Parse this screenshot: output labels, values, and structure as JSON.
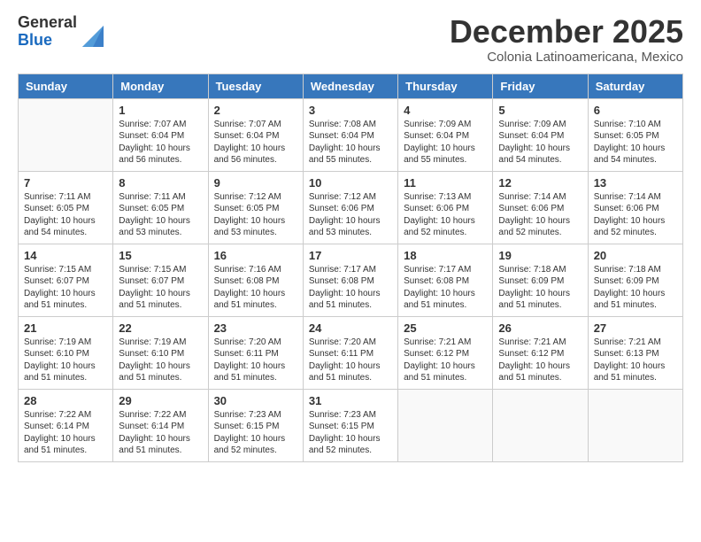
{
  "header": {
    "logo_general": "General",
    "logo_blue": "Blue",
    "month": "December 2025",
    "location": "Colonia Latinoamericana, Mexico"
  },
  "weekdays": [
    "Sunday",
    "Monday",
    "Tuesday",
    "Wednesday",
    "Thursday",
    "Friday",
    "Saturday"
  ],
  "weeks": [
    [
      {
        "day": "",
        "info": ""
      },
      {
        "day": "1",
        "info": "Sunrise: 7:07 AM\nSunset: 6:04 PM\nDaylight: 10 hours\nand 56 minutes."
      },
      {
        "day": "2",
        "info": "Sunrise: 7:07 AM\nSunset: 6:04 PM\nDaylight: 10 hours\nand 56 minutes."
      },
      {
        "day": "3",
        "info": "Sunrise: 7:08 AM\nSunset: 6:04 PM\nDaylight: 10 hours\nand 55 minutes."
      },
      {
        "day": "4",
        "info": "Sunrise: 7:09 AM\nSunset: 6:04 PM\nDaylight: 10 hours\nand 55 minutes."
      },
      {
        "day": "5",
        "info": "Sunrise: 7:09 AM\nSunset: 6:04 PM\nDaylight: 10 hours\nand 54 minutes."
      },
      {
        "day": "6",
        "info": "Sunrise: 7:10 AM\nSunset: 6:05 PM\nDaylight: 10 hours\nand 54 minutes."
      }
    ],
    [
      {
        "day": "7",
        "info": "Sunrise: 7:11 AM\nSunset: 6:05 PM\nDaylight: 10 hours\nand 54 minutes."
      },
      {
        "day": "8",
        "info": "Sunrise: 7:11 AM\nSunset: 6:05 PM\nDaylight: 10 hours\nand 53 minutes."
      },
      {
        "day": "9",
        "info": "Sunrise: 7:12 AM\nSunset: 6:05 PM\nDaylight: 10 hours\nand 53 minutes."
      },
      {
        "day": "10",
        "info": "Sunrise: 7:12 AM\nSunset: 6:06 PM\nDaylight: 10 hours\nand 53 minutes."
      },
      {
        "day": "11",
        "info": "Sunrise: 7:13 AM\nSunset: 6:06 PM\nDaylight: 10 hours\nand 52 minutes."
      },
      {
        "day": "12",
        "info": "Sunrise: 7:14 AM\nSunset: 6:06 PM\nDaylight: 10 hours\nand 52 minutes."
      },
      {
        "day": "13",
        "info": "Sunrise: 7:14 AM\nSunset: 6:06 PM\nDaylight: 10 hours\nand 52 minutes."
      }
    ],
    [
      {
        "day": "14",
        "info": "Sunrise: 7:15 AM\nSunset: 6:07 PM\nDaylight: 10 hours\nand 51 minutes."
      },
      {
        "day": "15",
        "info": "Sunrise: 7:15 AM\nSunset: 6:07 PM\nDaylight: 10 hours\nand 51 minutes."
      },
      {
        "day": "16",
        "info": "Sunrise: 7:16 AM\nSunset: 6:08 PM\nDaylight: 10 hours\nand 51 minutes."
      },
      {
        "day": "17",
        "info": "Sunrise: 7:17 AM\nSunset: 6:08 PM\nDaylight: 10 hours\nand 51 minutes."
      },
      {
        "day": "18",
        "info": "Sunrise: 7:17 AM\nSunset: 6:08 PM\nDaylight: 10 hours\nand 51 minutes."
      },
      {
        "day": "19",
        "info": "Sunrise: 7:18 AM\nSunset: 6:09 PM\nDaylight: 10 hours\nand 51 minutes."
      },
      {
        "day": "20",
        "info": "Sunrise: 7:18 AM\nSunset: 6:09 PM\nDaylight: 10 hours\nand 51 minutes."
      }
    ],
    [
      {
        "day": "21",
        "info": "Sunrise: 7:19 AM\nSunset: 6:10 PM\nDaylight: 10 hours\nand 51 minutes."
      },
      {
        "day": "22",
        "info": "Sunrise: 7:19 AM\nSunset: 6:10 PM\nDaylight: 10 hours\nand 51 minutes."
      },
      {
        "day": "23",
        "info": "Sunrise: 7:20 AM\nSunset: 6:11 PM\nDaylight: 10 hours\nand 51 minutes."
      },
      {
        "day": "24",
        "info": "Sunrise: 7:20 AM\nSunset: 6:11 PM\nDaylight: 10 hours\nand 51 minutes."
      },
      {
        "day": "25",
        "info": "Sunrise: 7:21 AM\nSunset: 6:12 PM\nDaylight: 10 hours\nand 51 minutes."
      },
      {
        "day": "26",
        "info": "Sunrise: 7:21 AM\nSunset: 6:12 PM\nDaylight: 10 hours\nand 51 minutes."
      },
      {
        "day": "27",
        "info": "Sunrise: 7:21 AM\nSunset: 6:13 PM\nDaylight: 10 hours\nand 51 minutes."
      }
    ],
    [
      {
        "day": "28",
        "info": "Sunrise: 7:22 AM\nSunset: 6:14 PM\nDaylight: 10 hours\nand 51 minutes."
      },
      {
        "day": "29",
        "info": "Sunrise: 7:22 AM\nSunset: 6:14 PM\nDaylight: 10 hours\nand 51 minutes."
      },
      {
        "day": "30",
        "info": "Sunrise: 7:23 AM\nSunset: 6:15 PM\nDaylight: 10 hours\nand 52 minutes."
      },
      {
        "day": "31",
        "info": "Sunrise: 7:23 AM\nSunset: 6:15 PM\nDaylight: 10 hours\nand 52 minutes."
      },
      {
        "day": "",
        "info": ""
      },
      {
        "day": "",
        "info": ""
      },
      {
        "day": "",
        "info": ""
      }
    ]
  ]
}
